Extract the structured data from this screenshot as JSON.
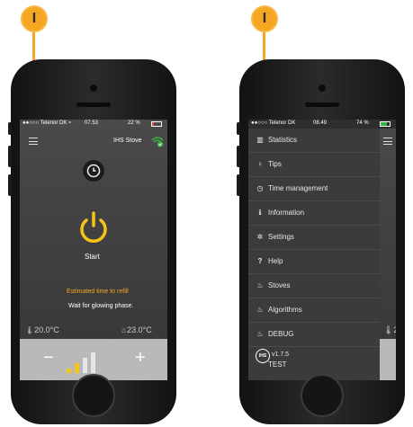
{
  "callouts": {
    "left_label": "I",
    "right_label": "I"
  },
  "left_phone": {
    "status": {
      "carrier": "●●○○○ Telenor DK",
      "wifi_icon": "wifi-icon",
      "time": "07.53",
      "battery": "22 %",
      "battery_level": 0.22
    },
    "device_label": "IHS Stove",
    "start_label": "Start",
    "refill_label": "Estimated time to refill",
    "phase_text": "Wait for glowing phase.",
    "temp_left": "20.0°C",
    "temp_right": "23.0°C",
    "minus_label": "−",
    "plus_label": "+",
    "power_level": 2,
    "colors": {
      "accent": "#f5c518",
      "wifi_ok": "#3cb043",
      "refill_text": "#f5a623"
    }
  },
  "right_phone": {
    "status": {
      "carrier": "●●○○○ Telenor DK",
      "time": "08.49",
      "battery": "74 %",
      "battery_level": 0.74
    },
    "menu": [
      {
        "label": "Statistics",
        "icon": "bar-chart-icon"
      },
      {
        "label": "Tips",
        "icon": "lightbulb-icon"
      },
      {
        "label": "Time management",
        "icon": "clock-icon"
      },
      {
        "label": "Information",
        "icon": "info-icon"
      },
      {
        "label": "Settings",
        "icon": "gear-icon"
      },
      {
        "label": "Help",
        "icon": "question-icon"
      },
      {
        "label": "Stoves",
        "icon": "flame-icon"
      },
      {
        "label": "Algorithms",
        "icon": "flame-icon"
      },
      {
        "label": "DEBUG",
        "icon": "flame-icon"
      },
      {
        "label": "TEST",
        "icon": "flame-icon"
      }
    ],
    "logo_text": "IHS",
    "version": "v1.7.5"
  }
}
